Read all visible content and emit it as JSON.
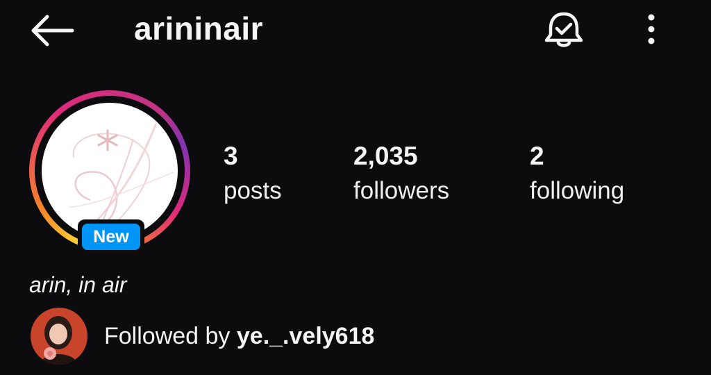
{
  "header": {
    "username": "arininair",
    "back_icon": "arrow-left-icon",
    "bell_icon": "bell-check-icon",
    "more_icon": "more-vertical-icon"
  },
  "profile": {
    "avatar_badge": "New",
    "display_name": "arin, in air",
    "ring_colors": [
      "#fdd835",
      "#f58529",
      "#dd2a7b",
      "#c13584",
      "#8134af"
    ],
    "badge_color": "#0095f6"
  },
  "stats": [
    {
      "value": "3",
      "label": "posts"
    },
    {
      "value": "2,035",
      "label": "followers"
    },
    {
      "value": "2",
      "label": "following"
    }
  ],
  "followed_by": {
    "prefix": "Followed by",
    "username": "ye._.vely618"
  }
}
